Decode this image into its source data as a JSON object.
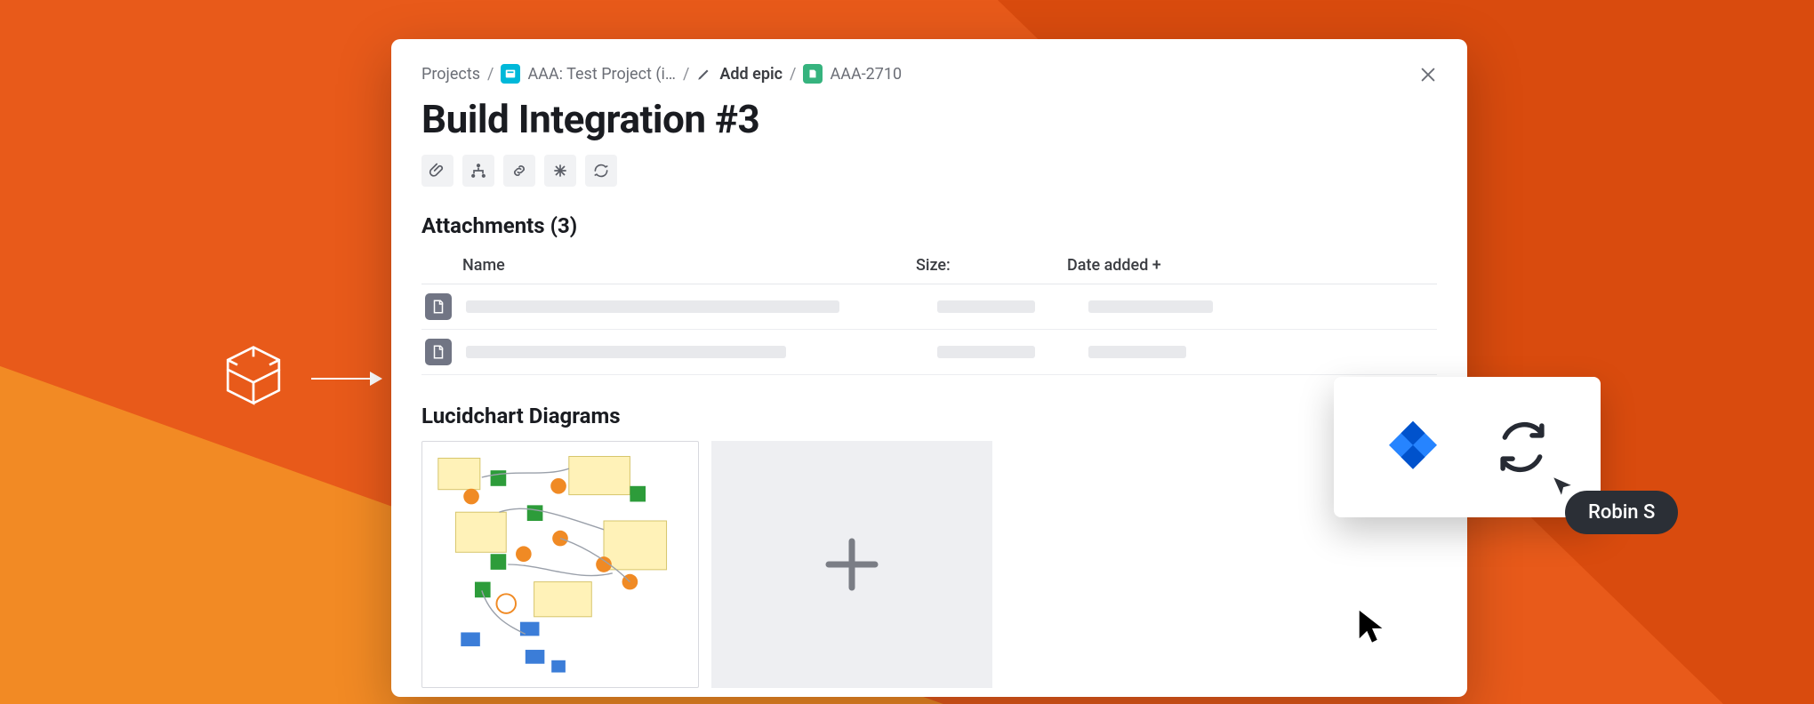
{
  "breadcrumb": {
    "projects": "Projects",
    "project_name": "AAA: Test Project (i…",
    "add_epic": "Add epic",
    "issue_key": "AAA-2710"
  },
  "title": "Build Integration #3",
  "attachments": {
    "heading": "Attachments (3)",
    "columns": {
      "name": "Name",
      "size": "Size:",
      "date": "Date added +"
    }
  },
  "lucidchart": {
    "heading": "Lucidchart Diagrams"
  },
  "collaborator": {
    "name": "Robin S"
  },
  "icons": {
    "attach": "attach-icon",
    "hierarchy": "hierarchy-icon",
    "link": "link-icon",
    "asterisk": "asterisk-icon",
    "sync": "sync-icon"
  }
}
